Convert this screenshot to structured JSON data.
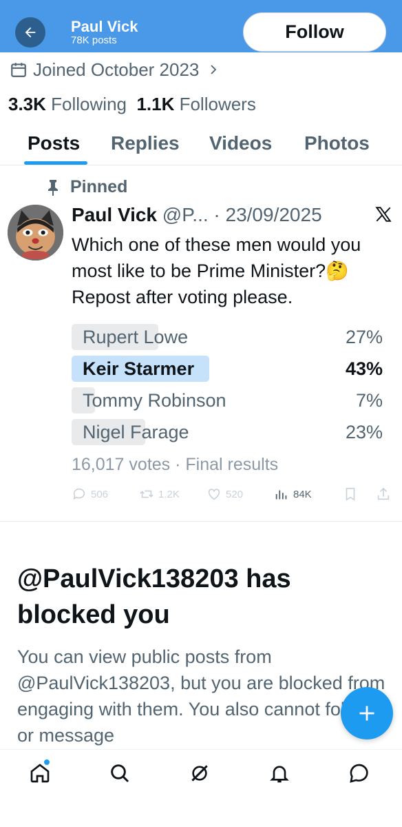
{
  "header": {
    "name": "Paul Vick",
    "posts": "78K posts",
    "follow_label": "Follow",
    "background": "#4a99e9"
  },
  "profile": {
    "joined": "Joined October 2023",
    "following_count": "3.3K",
    "following_label": "Following",
    "followers_count": "1.1K",
    "followers_label": "Followers"
  },
  "tabs": [
    {
      "label": "Posts",
      "active": true
    },
    {
      "label": "Replies",
      "active": false
    },
    {
      "label": "Videos",
      "active": false
    },
    {
      "label": "Photos",
      "active": false
    }
  ],
  "post": {
    "pinned_label": "Pinned",
    "author_name": "Paul Vick",
    "handle_date": "@P... · 23/09/2025",
    "text": "Which one of these men would you most like to be Prime Minister?🤔 Repost after voting please.",
    "poll": {
      "options": [
        {
          "label": "Rupert Lowe",
          "percent": "27%",
          "share": 27,
          "winner": false
        },
        {
          "label": "Keir Starmer",
          "percent": "43%",
          "share": 43,
          "winner": true
        },
        {
          "label": "Tommy Robinson",
          "percent": "7%",
          "share": 7,
          "winner": false
        },
        {
          "label": "Nigel Farage",
          "percent": "23%",
          "share": 23,
          "winner": false
        }
      ],
      "meta": "16,017 votes · Final results"
    },
    "actions": {
      "replies": "506",
      "reposts": "1.2K",
      "likes": "520",
      "views": "84K"
    }
  },
  "blocked": {
    "title": "@PaulVick138203 has blocked you",
    "text": "You can view public posts from @PaulVick138203, but you are blocked from engaging with them. You also cannot follow or message"
  },
  "accent": "#1d9bf0"
}
